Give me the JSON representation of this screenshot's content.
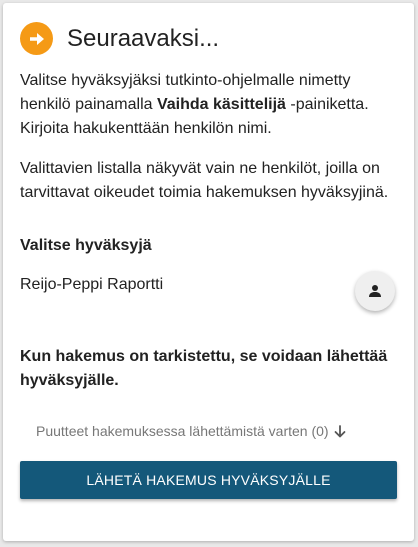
{
  "header": {
    "icon": "arrow-right-circle-icon",
    "title": "Seuraavaksi..."
  },
  "instructions": {
    "p1_before": "Valitse hyväksyjäksi tutkinto-ohjelmalle nimetty henkilö painamalla ",
    "p1_bold": "Vaihda käsittelijä",
    "p1_after": " -painiketta. Kirjoita hakukenttään henkilön nimi.",
    "p2": "Valittavien listalla näkyvät vain ne henkilöt, joilla on tarvittavat oikeudet toimia hakemuksen hyväksyjinä."
  },
  "approver": {
    "label": "Valitse hyväksyjä",
    "name": "Reijo-Peppi Raportti",
    "button_icon": "person-icon"
  },
  "info": {
    "text": "Kun hakemus on tarkistettu, se voidaan lähettää hyväksyjälle."
  },
  "deficiencies": {
    "label": "Puutteet hakemuksessa lähettämistä varten (0)",
    "icon": "arrow-down-icon"
  },
  "submit": {
    "label": "LÄHETÄ HAKEMUS HYVÄKSYJÄLLE"
  },
  "colors": {
    "accent": "#f59a16",
    "primary_button": "#14587a"
  }
}
